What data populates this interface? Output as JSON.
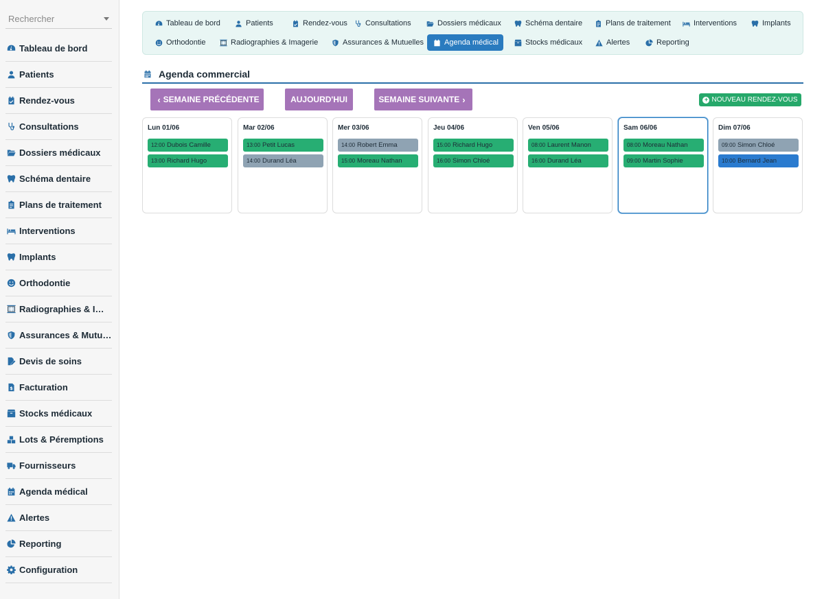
{
  "search": {
    "placeholder": "Rechercher"
  },
  "sidebar": {
    "items": [
      {
        "label": "Tableau de bord",
        "icon": "dashboard-icon"
      },
      {
        "label": "Patients",
        "icon": "user-icon"
      },
      {
        "label": "Rendez-vous",
        "icon": "calendar-check-icon"
      },
      {
        "label": "Consultations",
        "icon": "stethoscope-icon"
      },
      {
        "label": "Dossiers médicaux",
        "icon": "folder-open-icon"
      },
      {
        "label": "Schéma dentaire",
        "icon": "tooth-icon"
      },
      {
        "label": "Plans de traitement",
        "icon": "clipboard-icon"
      },
      {
        "label": "Interventions",
        "icon": "procedure-bed-icon"
      },
      {
        "label": "Implants",
        "icon": "tooth-icon"
      },
      {
        "label": "Orthodontie",
        "icon": "smile-icon"
      },
      {
        "label": "Radiographies & Imagerie",
        "icon": "x-ray-icon"
      },
      {
        "label": "Assurances & Mutuelles",
        "icon": "shield-icon"
      },
      {
        "label": "Devis de soins",
        "icon": "file-signature-icon"
      },
      {
        "label": "Facturation",
        "icon": "invoice-icon"
      },
      {
        "label": "Stocks médicaux",
        "icon": "box-icon"
      },
      {
        "label": "Lots & Péremptions",
        "icon": "boxes-icon"
      },
      {
        "label": "Fournisseurs",
        "icon": "truck-icon"
      },
      {
        "label": "Agenda médical",
        "icon": "calendar-icon"
      },
      {
        "label": "Alertes",
        "icon": "warning-icon"
      },
      {
        "label": "Reporting",
        "icon": "pie-chart-icon"
      },
      {
        "label": "Configuration",
        "icon": "gear-icon"
      }
    ]
  },
  "tabs": [
    {
      "label": "Tableau de bord",
      "icon": "dashboard-icon",
      "active": false
    },
    {
      "label": "Patients",
      "icon": "user-icon",
      "active": false
    },
    {
      "label": "Rendez-vous",
      "icon": "calendar-check-icon",
      "active": false
    },
    {
      "label": "Consultations",
      "icon": "stethoscope-icon",
      "active": false
    },
    {
      "label": "Dossiers médicaux",
      "icon": "folder-open-icon",
      "active": false
    },
    {
      "label": "Schéma dentaire",
      "icon": "tooth-icon",
      "active": false
    },
    {
      "label": "Plans de traitement",
      "icon": "clipboard-icon",
      "active": false
    },
    {
      "label": "Interventions",
      "icon": "procedure-bed-icon",
      "active": false
    },
    {
      "label": "Implants",
      "icon": "tooth-icon",
      "active": false
    },
    {
      "label": "Orthodontie",
      "icon": "smile-icon",
      "active": false
    },
    {
      "label": "Radiographies & Imagerie",
      "icon": "x-ray-icon",
      "active": false
    },
    {
      "label": "Assurances & Mutuelles",
      "icon": "shield-icon",
      "active": false
    },
    {
      "label": "Agenda médical",
      "icon": "calendar-icon",
      "active": true
    },
    {
      "label": "Stocks médicaux",
      "icon": "box-icon",
      "active": false
    },
    {
      "label": "Alertes",
      "icon": "warning-icon",
      "active": false
    },
    {
      "label": "Reporting",
      "icon": "pie-chart-icon",
      "active": false
    }
  ],
  "section": {
    "title": "Agenda commercial",
    "icon": "calendar-icon"
  },
  "toolbar": {
    "prev_label": "SEMAINE PRÉCÉDENTE",
    "today_label": "AUJOURD'HUI",
    "next_label": "SEMAINE SUIVANTE",
    "new_label": "NOUVEAU RENDEZ-VOUS"
  },
  "colors": {
    "accent": "#2a7bbf",
    "nav_button": "#a574b8",
    "new_button": "#26a86a",
    "event_green": "#27ae73",
    "event_grey": "#8fa3b3",
    "event_blue": "#2a7bcf"
  },
  "week": [
    {
      "label": "Lun 01/06",
      "today": false,
      "events": [
        {
          "time": "12:00",
          "name": "Dubois Camille",
          "status": "green"
        },
        {
          "time": "13:00",
          "name": "Richard Hugo",
          "status": "green"
        }
      ]
    },
    {
      "label": "Mar 02/06",
      "today": false,
      "events": [
        {
          "time": "13:00",
          "name": "Petit Lucas",
          "status": "green"
        },
        {
          "time": "14:00",
          "name": "Durand Léa",
          "status": "grey"
        }
      ]
    },
    {
      "label": "Mer 03/06",
      "today": false,
      "events": [
        {
          "time": "14:00",
          "name": "Robert Emma",
          "status": "grey"
        },
        {
          "time": "15:00",
          "name": "Moreau Nathan",
          "status": "green"
        }
      ]
    },
    {
      "label": "Jeu 04/06",
      "today": false,
      "events": [
        {
          "time": "15:00",
          "name": "Richard Hugo",
          "status": "green"
        },
        {
          "time": "16:00",
          "name": "Simon Chloé",
          "status": "green"
        }
      ]
    },
    {
      "label": "Ven 05/06",
      "today": false,
      "events": [
        {
          "time": "08:00",
          "name": "Laurent Manon",
          "status": "green"
        },
        {
          "time": "16:00",
          "name": "Durand Léa",
          "status": "green"
        }
      ]
    },
    {
      "label": "Sam 06/06",
      "today": true,
      "events": [
        {
          "time": "08:00",
          "name": "Moreau Nathan",
          "status": "green"
        },
        {
          "time": "09:00",
          "name": "Martin Sophie",
          "status": "green"
        }
      ]
    },
    {
      "label": "Dim 07/06",
      "today": false,
      "events": [
        {
          "time": "09:00",
          "name": "Simon Chloé",
          "status": "grey"
        },
        {
          "time": "10:00",
          "name": "Bernard Jean",
          "status": "blue"
        }
      ]
    }
  ]
}
